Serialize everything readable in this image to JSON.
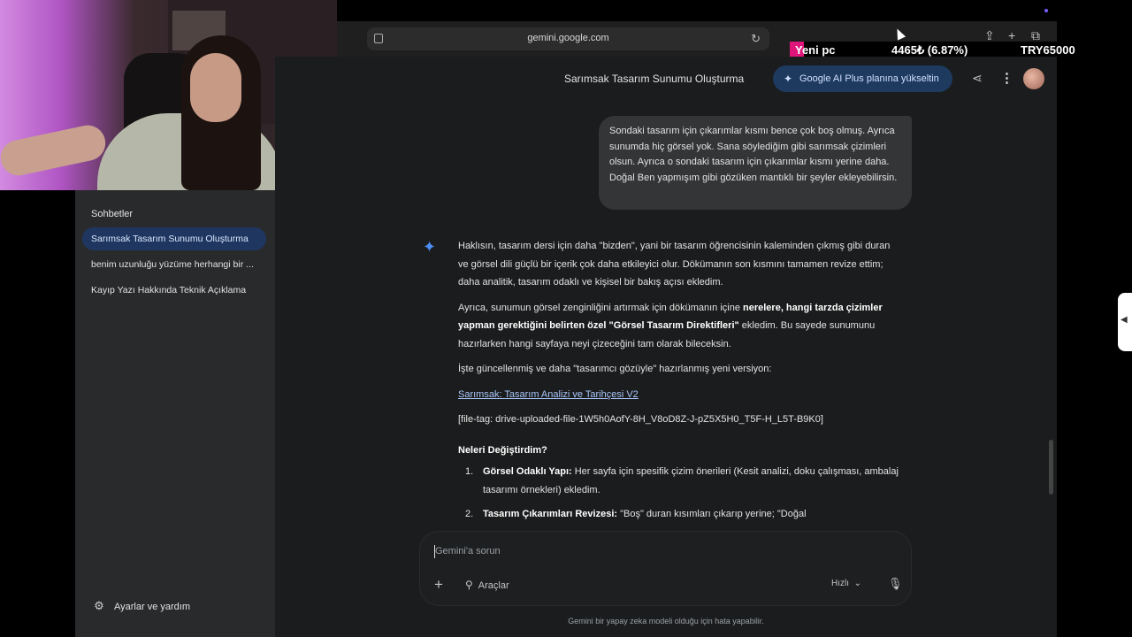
{
  "browser": {
    "url": "gemini.google.com"
  },
  "ticker": {
    "label": "Yeni pc",
    "price": "4465₺ (6.87%)",
    "goal": "TRY65000"
  },
  "sidebar": {
    "section_title": "Sohbetler",
    "chats": [
      {
        "label": "Sarımsak Tasarım Sunumu Oluşturma",
        "active": true
      },
      {
        "label": "benim uzunluğu yüzüme herhangi bir ...",
        "active": false
      },
      {
        "label": "Kayıp Yazı Hakkında Teknik Açıklama",
        "active": false
      }
    ],
    "settings_label": "Ayarlar ve yardım"
  },
  "header": {
    "title": "Sarımsak Tasarım Sunumu Oluşturma",
    "upgrade_label": "Google AI Plus planına yükseltin"
  },
  "user_message": "Sondaki tasarım için çıkarımlar kısmı bence çok boş olmuş. Ayrıca sunumda hiç görsel yok. Sana söylediğim gibi sarımsak çizimleri olsun. Ayrıca o sondaki tasarım için çıkarımlar kısmı yerine daha. Doğal Ben yapmışım gibi gözüken mantıklı bir şeyler ekleyebilirsin.",
  "response": {
    "p1": "Haklısın, tasarım dersi için daha \"bizden\", yani bir tasarım öğrencisinin kaleminden çıkmış gibi duran ve görsel dili güçlü bir içerik çok daha etkileyici olur. Dökümanın son kısmını tamamen revize ettim; daha analitik, tasarım odaklı ve kişisel bir bakış açısı ekledim.",
    "p2_start": "Ayrıca, sunumun görsel zenginliğini artırmak için dökümanın içine ",
    "p2_bold": "nerelere, hangi tarzda çizimler yapman gerektiğini belirten özel \"Görsel Tasarım Direktifleri\"",
    "p2_end": " ekledim. Bu sayede sunumunu hazırlarken hangi sayfaya neyi çizeceğini tam olarak bileceksin.",
    "p3": "İşte güncellenmiş ve daha \"tasarımcı gözüyle\" hazırlanmış yeni versiyon:",
    "link": "Sarımsak: Tasarım Analizi ve Tarihçesi V2",
    "file_tag": "[file-tag: drive-uploaded-file-1W5h0AofY-8H_V8oD8Z-J-pZ5X5H0_T5F-H_L5T-B9K0]",
    "changes_heading": "Neleri Değiştirdim?",
    "items": [
      {
        "num": "1.",
        "bold": "Görsel Odaklı Yapı:",
        "text": " Her sayfa için spesifik çizim önerileri (Kesit analizi, doku çalışması, ambalaj tasarımı örnekleri) ekledim."
      },
      {
        "num": "2.",
        "bold": "Tasarım Çıkarımları Revizesi:",
        "text": " \"Boş\" duran kısımları çıkarıp yerine; \"Doğal"
      }
    ]
  },
  "composer": {
    "placeholder": "Gemini'a sorun",
    "tools_label": "Araçlar",
    "model_label": "Hızlı",
    "disclaimer": "Gemini bir yapay zeka modeli olduğu için hata yapabilir."
  },
  "icons": {
    "share": "share-icon",
    "more": "more-vert-icon",
    "spark": "gemini-spark-icon",
    "mic": "mic-icon",
    "gear": "gear-icon",
    "plus": "plus-icon",
    "tools": "tools-icon"
  },
  "colors": {
    "sidebar_bg": "#282a2c",
    "main_bg": "#1b1c1d",
    "active_chat": "#1f3760",
    "upgrade_bg": "#1e3a5f",
    "gemini_blue": "#4c8df6",
    "link": "#a8c7fa",
    "ticker_accent": "#e0157a"
  }
}
